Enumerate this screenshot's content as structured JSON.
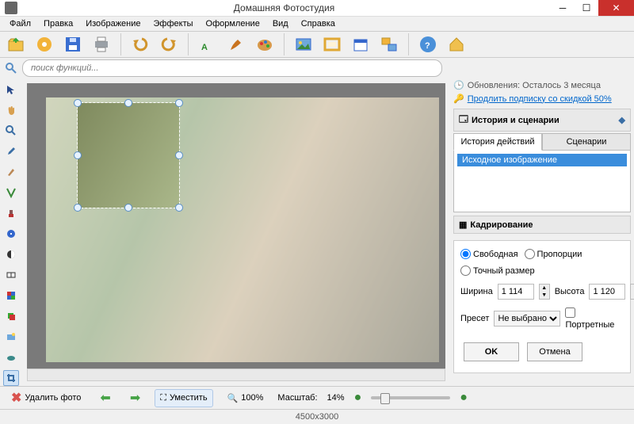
{
  "window": {
    "title": "Домашняя Фотостудия"
  },
  "menus": [
    "Файл",
    "Правка",
    "Изображение",
    "Эффекты",
    "Оформление",
    "Вид",
    "Справка"
  ],
  "search": {
    "placeholder": "поиск функций..."
  },
  "updates": {
    "line1": "Обновления: Осталось  3 месяца",
    "line2": "Продлить подписку со скидкой 50%"
  },
  "history_panel": {
    "title": "История и сценарии",
    "tabs": [
      "История действий",
      "Сценарии"
    ],
    "items": [
      "Исходное изображение"
    ]
  },
  "crop_panel": {
    "title": "Кадрирование",
    "modes": [
      "Свободная",
      "Пропорции",
      "Точный размер"
    ],
    "width_label": "Ширина",
    "width_value": "1 114",
    "height_label": "Высота",
    "height_value": "1 120",
    "preset_label": "Пресет",
    "preset_value": "Не выбрано",
    "portrait_label": "Портретные",
    "ok": "OK",
    "cancel": "Отмена"
  },
  "bottom": {
    "delete": "Удалить фото",
    "fit": "Уместить",
    "zoom100": "100%",
    "scale_label": "Масштаб:",
    "scale_value": "14%"
  },
  "status": {
    "dims": "4500x3000"
  },
  "toolbar_icons": [
    "open",
    "settings",
    "save",
    "print",
    "undo",
    "redo",
    "text",
    "paint",
    "palette",
    "image",
    "frame",
    "calendar",
    "switch",
    "help",
    "home"
  ],
  "side_icons": [
    "pointer",
    "hand",
    "zoom",
    "eyedrop",
    "brush",
    "pencil",
    "stamp",
    "shape",
    "gradient",
    "levels",
    "curves",
    "layers",
    "overlay",
    "eraser",
    "crop"
  ]
}
